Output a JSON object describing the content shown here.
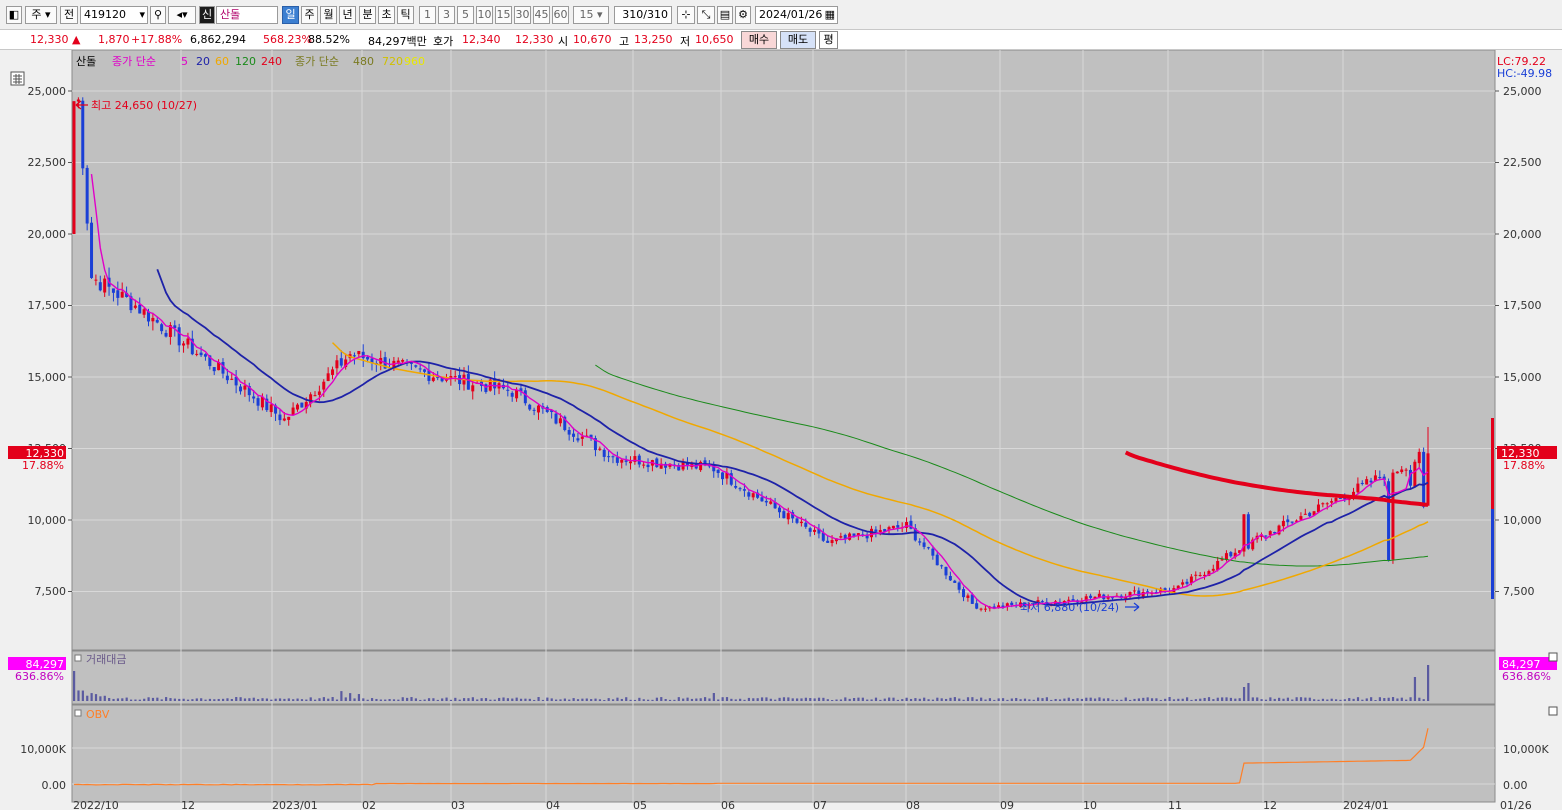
{
  "toolbar": {
    "market": "주",
    "scope": "전",
    "code": "419120",
    "name_badge": "신",
    "name": "산돌",
    "periods": [
      "일",
      "주",
      "월",
      "년",
      "분",
      "초",
      "틱"
    ],
    "selected_period": "일",
    "intervals": [
      "1",
      "3",
      "5",
      "10",
      "15",
      "30",
      "45",
      "60"
    ],
    "interval_value": "15",
    "count": "310",
    "count_total": "/310",
    "date": "2024/01/26"
  },
  "quote": {
    "price": "12,330 ▲",
    "change": "1,870",
    "change_pct": "+17.88%",
    "volume": "6,862,294",
    "vol_ratio": "568.23%",
    "turnover": "88.52%",
    "amount": "84,297백만",
    "bid_label": "호가",
    "ask": "12,340",
    "bid": "12,330",
    "open_label": "시",
    "open": "10,670",
    "high_label": "고",
    "high": "13,250",
    "low_label": "저",
    "low": "10,650",
    "buy_label": "매수",
    "sell_label": "매도",
    "avg_label": "평"
  },
  "colors": {
    "up": "#e3001b",
    "down": "#1a3fd6",
    "ma5": "#e000c8",
    "ma20": "#1e22a8",
    "ma60": "#f0a800",
    "ma120": "#1a8a1a",
    "obv": "#ff7f27",
    "background": "#c0c0c0"
  },
  "chart_data": [
    {
      "type": "candlestick",
      "title": "산돌",
      "legend": {
        "name": "산돌",
        "ma_label": "종가 단순",
        "ma_periods": [
          "5",
          "20",
          "60",
          "120",
          "240"
        ],
        "ma2_label": "종가 단순",
        "ma2_periods": [
          "480",
          "720",
          "960"
        ]
      },
      "y_ticks": [
        "25,000",
        "22,500",
        "20,000",
        "17,500",
        "15,000",
        "12,500",
        "10,000",
        "7,500"
      ],
      "ylim": [
        6000,
        26000
      ],
      "x_ticks": [
        "2022/10",
        "12",
        "2023/01",
        "02",
        "03",
        "04",
        "05",
        "06",
        "07",
        "08",
        "09",
        "10",
        "11",
        "12",
        "2024/01",
        "01/26"
      ],
      "current_price": "12,330",
      "current_pct": "17.88%",
      "lc": "LC:79.22",
      "hc": "HC:-49.98",
      "high_annotation": "최고 24,650 (10/27)",
      "low_annotation": "최저 6,880 (10/24)",
      "key_points": [
        {
          "date": "2022/10/27",
          "price": 24650
        },
        {
          "date": "2022/11 mid",
          "price": 17500
        },
        {
          "date": "2022/12 end",
          "price": 13500
        },
        {
          "date": "2023/02 mid",
          "price": 15800
        },
        {
          "date": "2023/03 mid",
          "price": 15000
        },
        {
          "date": "2023/04 mid",
          "price": 14500
        },
        {
          "date": "2023/05 mid",
          "price": 12200
        },
        {
          "date": "2023/06 end",
          "price": 11800
        },
        {
          "date": "2023/08 mid",
          "price": 9200
        },
        {
          "date": "2023/09 mid",
          "price": 9800
        },
        {
          "date": "2023/10/24",
          "price": 6880
        },
        {
          "date": "2023/12 mid",
          "price": 7600
        },
        {
          "date": "2024/01 start",
          "price": 9200
        },
        {
          "date": "2024/01/26",
          "price": 12330
        }
      ]
    },
    {
      "type": "bar",
      "title": "거래대금",
      "current_value": "84,297",
      "current_pct": "636.86%"
    },
    {
      "type": "line",
      "title": "OBV",
      "y_ticks": [
        "10,000K",
        "0.00"
      ]
    }
  ]
}
